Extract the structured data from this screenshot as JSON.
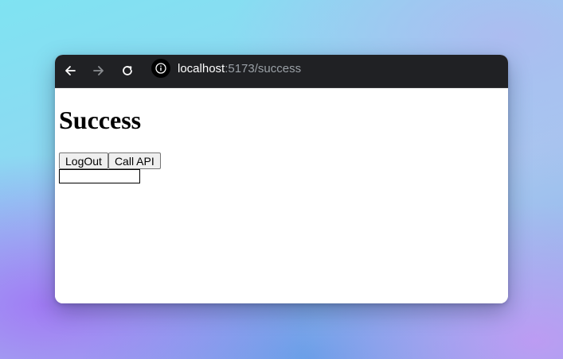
{
  "browser": {
    "address": {
      "host": "localhost",
      "path": ":5173/success"
    },
    "icons": {
      "back": "back-arrow-icon",
      "forward": "forward-arrow-icon",
      "reload": "reload-icon",
      "site_info": "info-icon"
    }
  },
  "page": {
    "title": "Success",
    "logout_label": "LogOut",
    "call_api_label": "Call API",
    "input": {
      "value": "",
      "placeholder": ""
    }
  },
  "colors": {
    "toolbar_bg": "#202124",
    "page_bg": "#ffffff",
    "url_host": "#ffffff",
    "url_path": "#9aa0a6"
  }
}
